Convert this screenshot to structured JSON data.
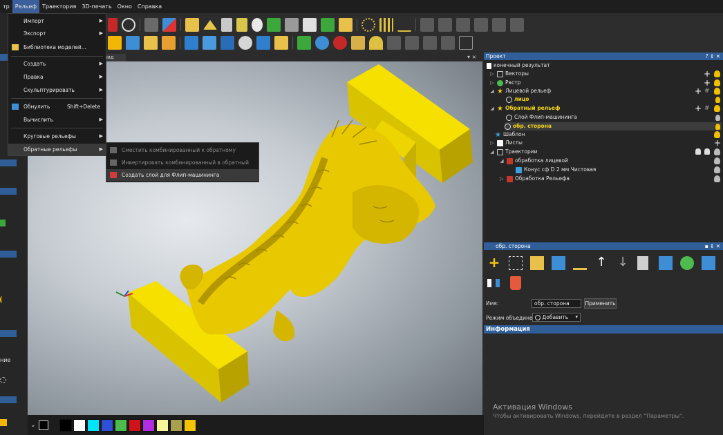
{
  "menubar": {
    "items": [
      "тр",
      "Рельеф",
      "Траектория",
      "3D-печать",
      "Окно",
      "Справка"
    ]
  },
  "relief_menu": {
    "items": [
      {
        "label": "Импорт",
        "submenu": true
      },
      {
        "label": "Экспорт",
        "submenu": true
      },
      {
        "label": "Библиотека моделей...",
        "icon": "folder-icon"
      },
      {
        "label": "Создать",
        "submenu": true
      },
      {
        "label": "Правка",
        "submenu": true
      },
      {
        "label": "Скульптурировать",
        "submenu": true
      },
      {
        "label": "Обнулить",
        "shortcut": "Shift+Delete",
        "icon": "reset-relief-icon"
      },
      {
        "label": "Вычислить",
        "submenu": true
      },
      {
        "label": "Круговые рельефы",
        "submenu": true
      },
      {
        "label": "Обратные рельефы",
        "submenu": true,
        "highlighted": true
      }
    ]
  },
  "back_relief_submenu": {
    "items": [
      {
        "label": "Сместить комбинированный к обратному",
        "disabled": true
      },
      {
        "label": "Инвертировать комбинированный в обратный",
        "disabled": true
      },
      {
        "label": "Создать слой для Флип-машининга",
        "highlighted": true
      }
    ]
  },
  "viewport": {
    "tab_label": "вид",
    "close_label": "▾ ×"
  },
  "project_panel": {
    "title": "Проект",
    "header_buttons": "? ⇕ ✕",
    "tree": [
      {
        "label": "конечный результат",
        "level": 0,
        "icon": "document-icon"
      },
      {
        "label": "Векторы",
        "level": 1,
        "icon": "vectors-icon"
      },
      {
        "label": "Растр",
        "level": 1,
        "icon": "raster-icon"
      },
      {
        "label": "Лицевой рельеф",
        "level": 1,
        "icon": "star-icon"
      },
      {
        "label": "лицо",
        "level": 2,
        "icon": "layer-add-icon",
        "bold": true
      },
      {
        "label": "Обратный рельеф",
        "level": 1,
        "icon": "star-icon",
        "bold": true
      },
      {
        "label": "Слой Флип-машининга",
        "level": 2,
        "icon": "layer-add-icon"
      },
      {
        "label": "обр. сторона",
        "level": 2,
        "icon": "layer-add-icon",
        "bold": true,
        "selected": true
      },
      {
        "label": "Шаблон",
        "level": 1,
        "icon": "template-star-icon"
      },
      {
        "label": "Листы",
        "level": 1,
        "icon": "sheets-icon"
      },
      {
        "label": "Траектории",
        "level": 1,
        "icon": "toolpaths-icon"
      },
      {
        "label": "обработка лицевой",
        "level": 2,
        "icon": "toolpath-group-icon"
      },
      {
        "label": "Конус сф D 2 мм Чистовая",
        "level": 3,
        "icon": "tool-icon"
      },
      {
        "label": "Обработка Рельефа",
        "level": 2,
        "icon": "toolpath-group-icon"
      }
    ]
  },
  "layer_panel": {
    "title": "обр. сторона",
    "header_buttons": "▪ ⇕ ✕",
    "name_label": "Имя:",
    "name_value": "обр. сторона",
    "apply_label": "Применить",
    "merge_mode_label": "Режим объединения:",
    "merge_mode_value": "Добавить",
    "info_title": "Информация"
  },
  "left_strip": {
    "label_ie": "ние"
  },
  "watermark": {
    "title": "Активация Windows",
    "subtitle": "Чтобы активировать Windows, перейдите в раздел \"Параметры\"."
  },
  "colors": {
    "accent": "#2f5e99",
    "relief_yellow": "#f2d21b",
    "swatches": [
      "#000000",
      "#ffffff",
      "#00e5ff",
      "#2e4fd6",
      "#4dbb4d",
      "#d0121b",
      "#b02ee0",
      "#f8f59a",
      "#a8a04a",
      "#f5c400"
    ]
  }
}
